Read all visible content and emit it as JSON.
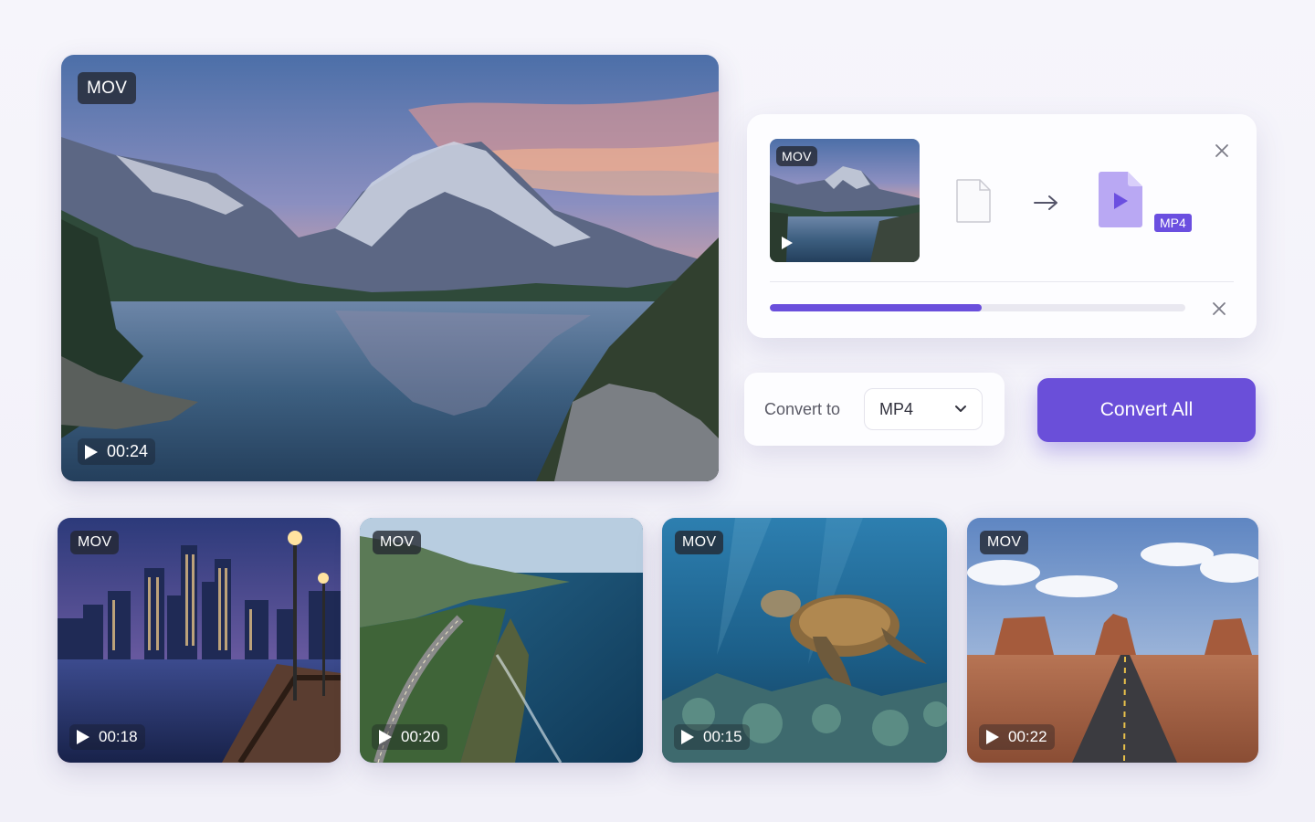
{
  "main_preview": {
    "format_badge": "MOV",
    "duration": "00:24",
    "scene": "mountain-lake-sunset"
  },
  "conversion_panel": {
    "source_thumbnail": {
      "format_badge": "MOV",
      "scene": "mountain-lake-sunset"
    },
    "source_file_icon": "file-icon",
    "arrow_icon": "arrow-right-icon",
    "target_file_icon": "video-file-icon",
    "target_format_tag": "MP4",
    "progress_fraction": 0.51,
    "close_icon": "close-icon",
    "cancel_icon": "close-icon"
  },
  "convert_to": {
    "label": "Convert to",
    "selected_format": "MP4",
    "dropdown_icon": "chevron-down-icon"
  },
  "convert_all_button": {
    "label": "Convert All"
  },
  "thumbnails": [
    {
      "format_badge": "MOV",
      "duration": "00:18",
      "scene": "city-waterfront-night"
    },
    {
      "format_badge": "MOV",
      "duration": "00:20",
      "scene": "coastal-road-aerial"
    },
    {
      "format_badge": "MOV",
      "duration": "00:15",
      "scene": "sea-turtle-reef"
    },
    {
      "format_badge": "MOV",
      "duration": "00:22",
      "scene": "desert-highway"
    }
  ],
  "colors": {
    "accent": "#6a4fd9",
    "progress_fill": "#6a4fdc",
    "progress_track": "#e9e8f0",
    "badge_bg": "#222630",
    "file_icon_purple": "#b9a8f3",
    "background": "#f4f3fa"
  }
}
